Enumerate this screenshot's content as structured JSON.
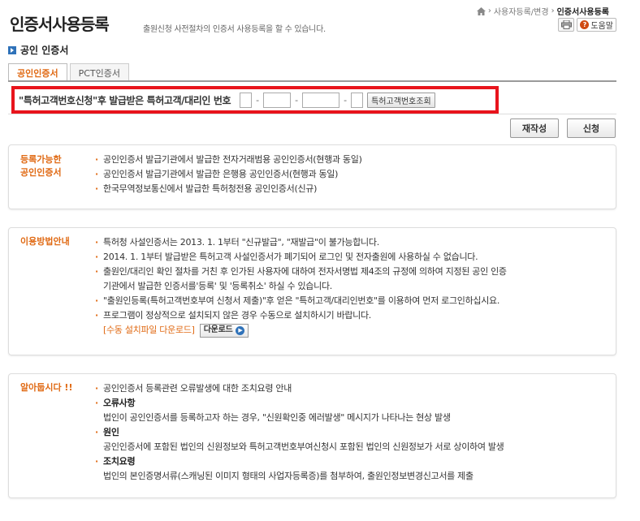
{
  "header": {
    "title": "인증서사용등록",
    "description": "출원신청 사전절차의 인증서 사용등록을 할 수 있습니다.",
    "breadcrumb": [
      "사용자등록/변경",
      "인증서사용등록"
    ],
    "help_label": "도움말"
  },
  "section": {
    "title": "공인 인증서"
  },
  "tabs": [
    {
      "label": "공인인증서",
      "active": true
    },
    {
      "label": "PCT인증서",
      "active": false
    }
  ],
  "number_row": {
    "label": "\"특허고객번호신청\"후 발급받은 특허고객/대리인 번호",
    "separator": "-",
    "lookup_label": "특허고객번호조회"
  },
  "actions": {
    "rewrite_label": "재작성",
    "apply_label": "신청"
  },
  "box1": {
    "title_line1": "등록가능한",
    "title_line2": "공인인증서",
    "items": [
      "공인인증서 발급기관에서 발급한 전자거래범용 공인인증서(현행과 동일)",
      "공인인증서 발급기관에서 발급한 은행용 공인인증서(현행과 동일)",
      "한국무역정보통신에서 발급한 특허청전용 공인인증서(신규)"
    ]
  },
  "box2": {
    "title": "이용방법안내",
    "items": [
      "특허청 사설인증서는 2013. 1. 1부터 \"신규발급\", \"재발급\"이 불가능합니다.",
      "2014. 1. 1부터 발급받은 특허고객 사설인증서가 폐기되어 로그인 및 전자출원에 사용하실 수 없습니다.",
      "출원인/대리인 확인 절차를 거친 후 인가된 사용자에 대하여 전자서명법 제4조의 규정에 의하여 지정된 공인 인증",
      "기관에서 발급한 인증서를'등록' 및 '등록취소' 하실 수 있습니다.",
      "\"출원인등록(특허고객번호부여 신청서 제출)\"후 얻은 \"특허고객/대리인번호\"를 이용하여 먼저 로그인하십시요.",
      "프로그램이 정상적으로 설치되지 않은 경우 수동으로 설치하시기 바랍니다."
    ],
    "download_link": "[수동 설치파일 다운로드]",
    "download_button": "다운로드"
  },
  "box3": {
    "title": "알아둡시다 !!",
    "items": [
      "공인인증서 등록관련 오류발생에 대한 조치요령 안내",
      "오류사항",
      "법인이 공인인증서를 등록하고자 하는 경우, \"신원확인중 에러발생\" 메시지가 나타나는 현상 발생",
      "원인",
      "공인인증서에 포함된 법인의 신원정보와 특허고객번호부여신청시 포함된 법인의 신원정보가 서로 상이하여 발생",
      "조치요령",
      "법인의 본인증명서류(스캐닝된 이미지 형태의 사업자등록증)를 첨부하여, 출원인정보변경신고서를 제출"
    ]
  },
  "colors": {
    "accent": "#e06a14",
    "highlight_border": "#e8141c",
    "blue": "#2f72b9"
  }
}
